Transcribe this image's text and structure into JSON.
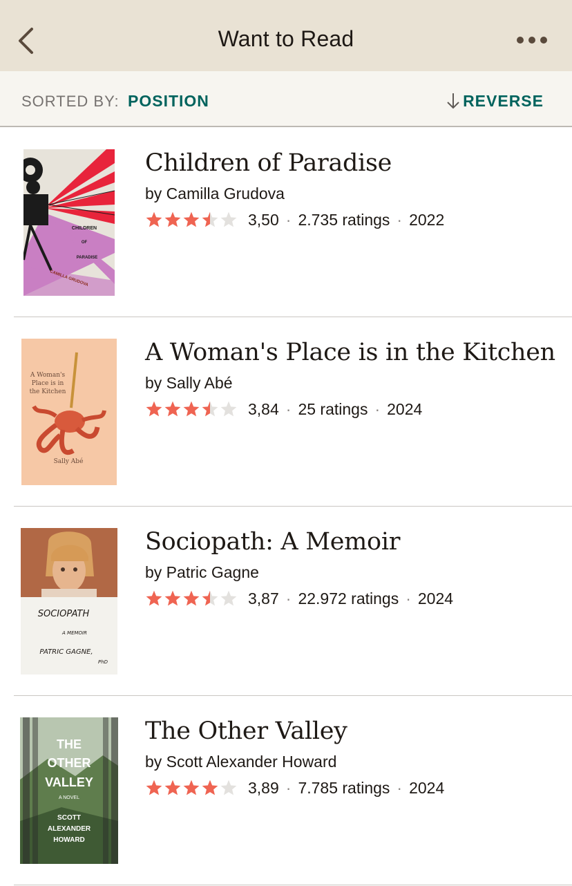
{
  "header": {
    "title": "Want to Read",
    "back_icon": "chevron-left-icon",
    "more_icon": "ellipsis-icon"
  },
  "sort": {
    "label": "SORTED BY:",
    "value": "POSITION",
    "reverse_label": "REVERSE",
    "reverse_icon": "arrow-down-icon"
  },
  "colors": {
    "header_bg": "#e9e2d4",
    "accent": "#00635d",
    "star_filled": "#ef6452",
    "star_empty": "#e3e1de"
  },
  "books": [
    {
      "title": "Children of Paradise",
      "author": "by Camilla Grudova",
      "avg_rating": "3,50",
      "stars": 3.5,
      "ratings": "2.735 ratings",
      "year": "2022",
      "cover_text": [
        "CHILDREN",
        "OF",
        "PARADISE",
        "CAMILLA GRUDOVA"
      ]
    },
    {
      "title": "A Woman's Place is in the Kitchen",
      "author": "by Sally Abé",
      "avg_rating": "3,84",
      "stars": 3.5,
      "ratings": "25 ratings",
      "year": "2024",
      "cover_text": [
        "A Woman's",
        "Place is in",
        "the Kitchen",
        "Sally Abé"
      ]
    },
    {
      "title": "Sociopath: A Memoir",
      "author": "by Patric Gagne",
      "avg_rating": "3,87",
      "stars": 3.5,
      "ratings": "22.972 ratings",
      "year": "2024",
      "cover_text": [
        "SOCIOPATH",
        "A MEMOIR",
        "PATRIC GAGNE,",
        "PhD"
      ]
    },
    {
      "title": "The Other Valley",
      "author": "by Scott Alexander Howard",
      "avg_rating": "3,89",
      "stars": 4,
      "ratings": "7.785 ratings",
      "year": "2024",
      "cover_text": [
        "THE",
        "OTHER",
        "VALLEY",
        "A NOVEL",
        "SCOTT",
        "ALEXANDER",
        "HOWARD"
      ]
    }
  ]
}
